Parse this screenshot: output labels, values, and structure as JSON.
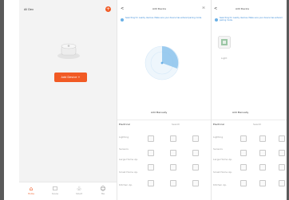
{
  "screen1": {
    "home_label": "All Dev",
    "add_button": "+",
    "cta_label": "Add Device +",
    "tabs": [
      {
        "label": "Home",
        "icon": "home-icon"
      },
      {
        "label": "Scene",
        "icon": "scene-icon"
      },
      {
        "label": "Smart",
        "icon": "smart-icon"
      },
      {
        "label": "Me",
        "icon": "me-icon"
      }
    ]
  },
  "screen2": {
    "back": "<",
    "title": "Add Device",
    "scan": "⌘",
    "notice": "Searching for nearby devices. Make sure your device has entered pairing mode.",
    "section": "Add Manually",
    "categories": [
      "Electrical",
      "Lighting",
      "Sensors",
      "Large Home Ap.",
      "Small Home Ap.",
      "Kitchen Ap."
    ],
    "search_tab": "Search"
  },
  "screen3": {
    "back": "<",
    "title": "Add Device",
    "notice": "Searching for nearby devices. Make sure your device has entered pairing mode.",
    "found_label": "Light",
    "section": "Add Manually",
    "categories": [
      "Electrical",
      "Lighting",
      "Sensors",
      "Large Home Ap.",
      "Small Home Ap.",
      "Kitchen Ap."
    ],
    "search_tab": "Search"
  },
  "colors": {
    "accent": "#f15a24",
    "link": "#3a8bd8",
    "radar": "#6ab0e6"
  }
}
